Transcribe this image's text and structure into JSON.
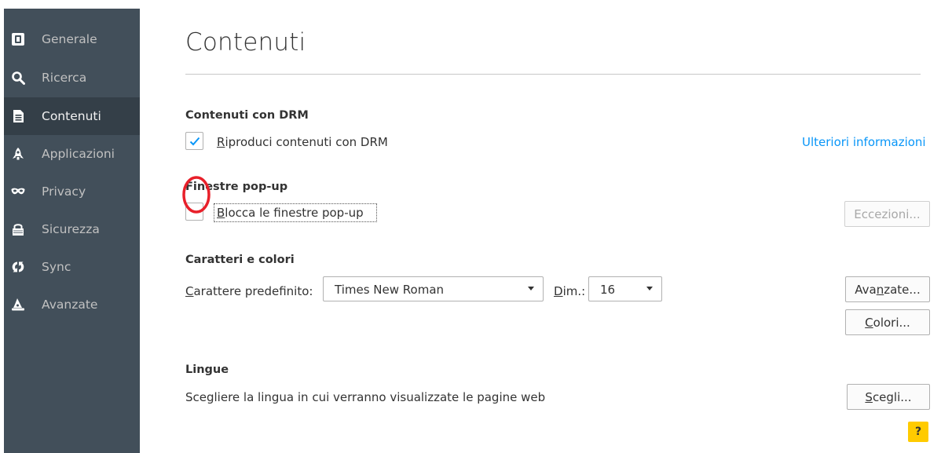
{
  "sidebar": {
    "items": [
      {
        "label": "Generale",
        "icon": "general-icon",
        "active": false
      },
      {
        "label": "Ricerca",
        "icon": "search-icon",
        "active": false
      },
      {
        "label": "Contenuti",
        "icon": "document-icon",
        "active": true
      },
      {
        "label": "Applicazioni",
        "icon": "rocket-icon",
        "active": false
      },
      {
        "label": "Privacy",
        "icon": "mask-icon",
        "active": false
      },
      {
        "label": "Sicurezza",
        "icon": "lock-icon",
        "active": false
      },
      {
        "label": "Sync",
        "icon": "sync-icon",
        "active": false
      },
      {
        "label": "Avanzate",
        "icon": "wizard-hat-icon",
        "active": false
      }
    ],
    "colors": {
      "background": "#424f5a",
      "active_background": "#343f48",
      "text": "#c1c1c1"
    }
  },
  "main": {
    "title": "Contenuti",
    "drm": {
      "heading": "Contenuti con DRM",
      "checkbox_label_accel": "R",
      "checkbox_label_rest": "iproduci contenuti con DRM",
      "checked": true,
      "link": "Ulteriori informazioni"
    },
    "popup": {
      "heading": "Finestre pop-up",
      "checkbox_label_accel": "B",
      "checkbox_label_rest": "locca le finestre pop-up",
      "checked": false,
      "exceptions_button": "Eccezioni..."
    },
    "fonts": {
      "heading": "Caratteri e colori",
      "default_font_label_accel": "C",
      "default_font_label_rest": "arattere predefinito:",
      "default_font_value": "Times New Roman",
      "size_label_accel": "D",
      "size_label_rest": "im.:",
      "size_value": "16",
      "advanced_button_pre": "Ava",
      "advanced_button_accel": "n",
      "advanced_button_post": "zate...",
      "colors_button_accel": "C",
      "colors_button_rest": "olori..."
    },
    "languages": {
      "heading": "Lingue",
      "description": "Scegliere la lingua in cui verranno visualizzate le pagine web",
      "choose_button_accel": "S",
      "choose_button_rest": "cegli..."
    },
    "help_button": "?"
  },
  "colors": {
    "accent": "#0996f8",
    "annotation": "#e8202a",
    "help": "#ffcb00"
  }
}
